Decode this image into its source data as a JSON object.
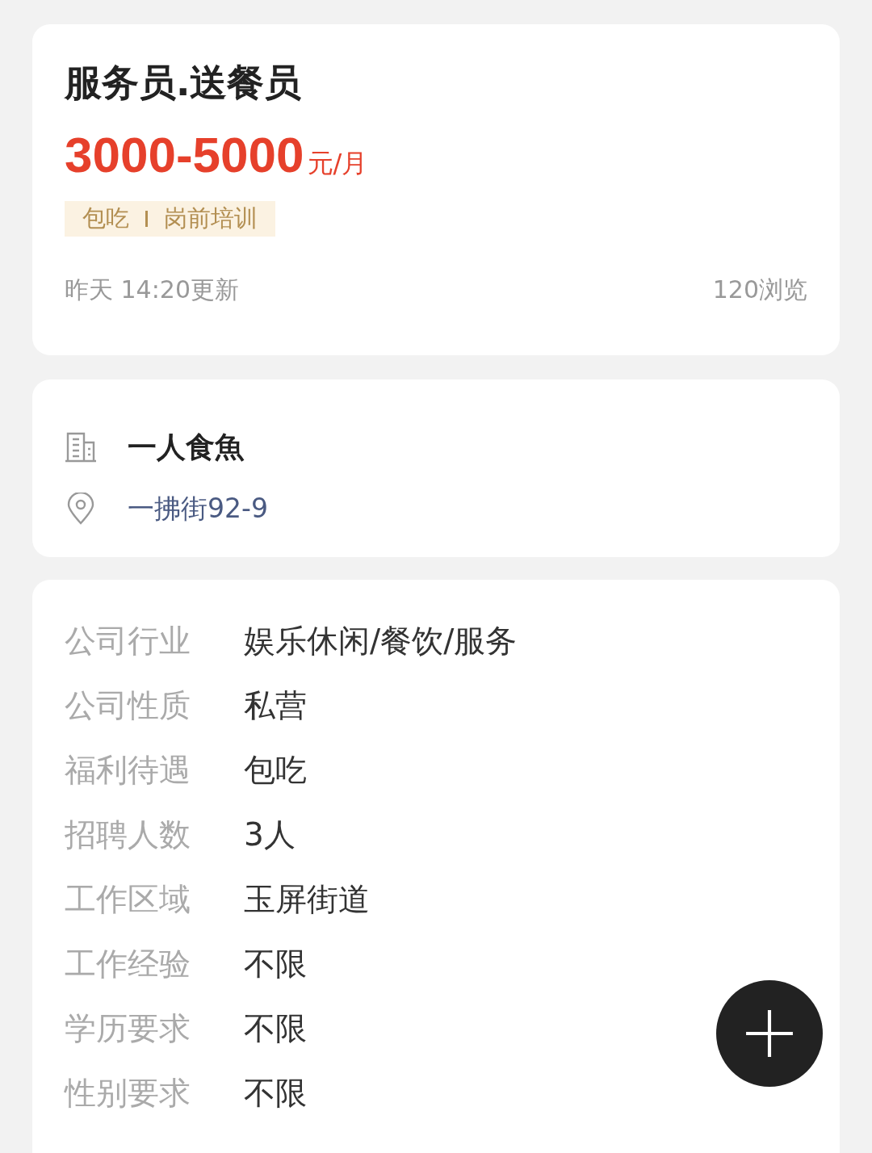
{
  "job": {
    "title": "服务员.送餐员",
    "salary": "3000-5000",
    "salary_unit": "元/月",
    "tags": [
      "包吃",
      "岗前培训"
    ],
    "updated": "昨天 14:20更新",
    "views": "120浏览"
  },
  "company": {
    "name": "一人食魚",
    "address": "一拂街92-9"
  },
  "details": [
    {
      "label": "公司行业",
      "value": "娱乐休闲/餐饮/服务"
    },
    {
      "label": "公司性质",
      "value": "私营"
    },
    {
      "label": "福利待遇",
      "value": "包吃"
    },
    {
      "label": "招聘人数",
      "value": "3人"
    },
    {
      "label": "工作区域",
      "value": "玉屏街道"
    },
    {
      "label": "工作经验",
      "value": "不限"
    },
    {
      "label": "学历要求",
      "value": "不限"
    },
    {
      "label": "性别要求",
      "value": "不限"
    }
  ]
}
